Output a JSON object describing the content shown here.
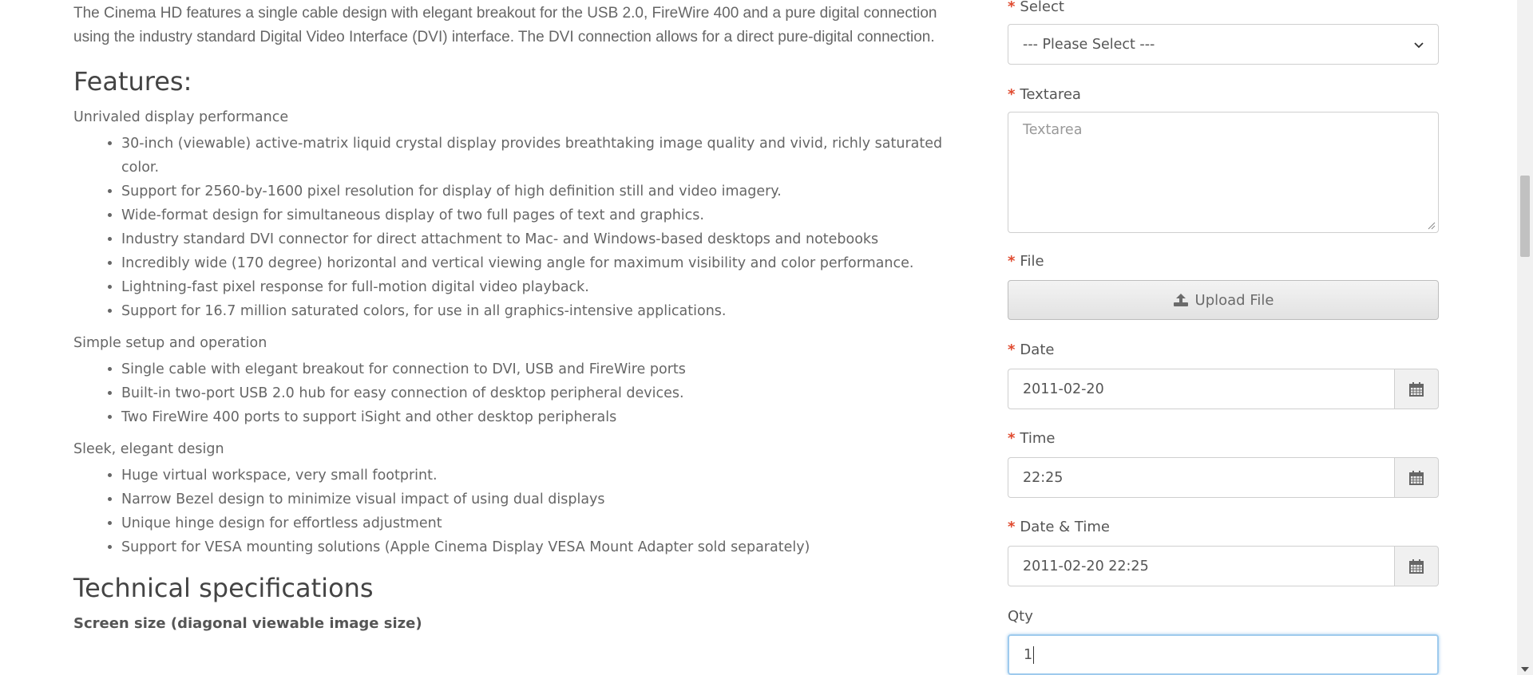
{
  "description": {
    "intro": "The Cinema HD features a single cable design with elegant breakout for the USB 2.0, FireWire 400 and a pure digital connection using the industry standard Digital Video Interface (DVI) interface. The DVI connection allows for a direct pure-digital connection.",
    "features_heading": "Features:",
    "groups": [
      {
        "title": "Unrivaled display performance",
        "items": [
          "30-inch (viewable) active-matrix liquid crystal display provides breathtaking image quality and vivid, richly saturated color.",
          "Support for 2560-by-1600 pixel resolution for display of high definition still and video imagery.",
          "Wide-format design for simultaneous display of two full pages of text and graphics.",
          "Industry standard DVI connector for direct attachment to Mac- and Windows-based desktops and notebooks",
          "Incredibly wide (170 degree) horizontal and vertical viewing angle for maximum visibility and color performance.",
          "Lightning-fast pixel response for full-motion digital video playback.",
          "Support for 16.7 million saturated colors, for use in all graphics-intensive applications."
        ]
      },
      {
        "title": "Simple setup and operation",
        "items": [
          "Single cable with elegant breakout for connection to DVI, USB and FireWire ports",
          "Built-in two-port USB 2.0 hub for easy connection of desktop peripheral devices.",
          "Two FireWire 400 ports to support iSight and other desktop peripherals"
        ]
      },
      {
        "title": "Sleek, elegant design",
        "items": [
          "Huge virtual workspace, very small footprint.",
          "Narrow Bezel design to minimize visual impact of using dual displays",
          "Unique hinge design for effortless adjustment",
          "Support for VESA mounting solutions (Apple Cinema Display VESA Mount Adapter sold separately)"
        ]
      }
    ],
    "tech_heading": "Technical specifications",
    "screen_size_label": "Screen size (diagonal viewable image size)"
  },
  "form": {
    "select": {
      "label": "Select",
      "value": "--- Please Select ---"
    },
    "textarea": {
      "label": "Textarea",
      "placeholder": "Textarea"
    },
    "file": {
      "label": "File",
      "button": "Upload File"
    },
    "date": {
      "label": "Date",
      "value": "2011-02-20"
    },
    "time": {
      "label": "Time",
      "value": "22:25"
    },
    "datetime": {
      "label": "Date & Time",
      "value": "2011-02-20 22:25"
    },
    "qty": {
      "label": "Qty",
      "value": "1"
    },
    "required_marker": "*"
  },
  "colors": {
    "required": "#e04a2f",
    "focus": "#9ecaed"
  },
  "icons": {
    "upload": "upload-icon",
    "calendar": "calendar-icon",
    "chevron": "chevron-down-icon"
  }
}
